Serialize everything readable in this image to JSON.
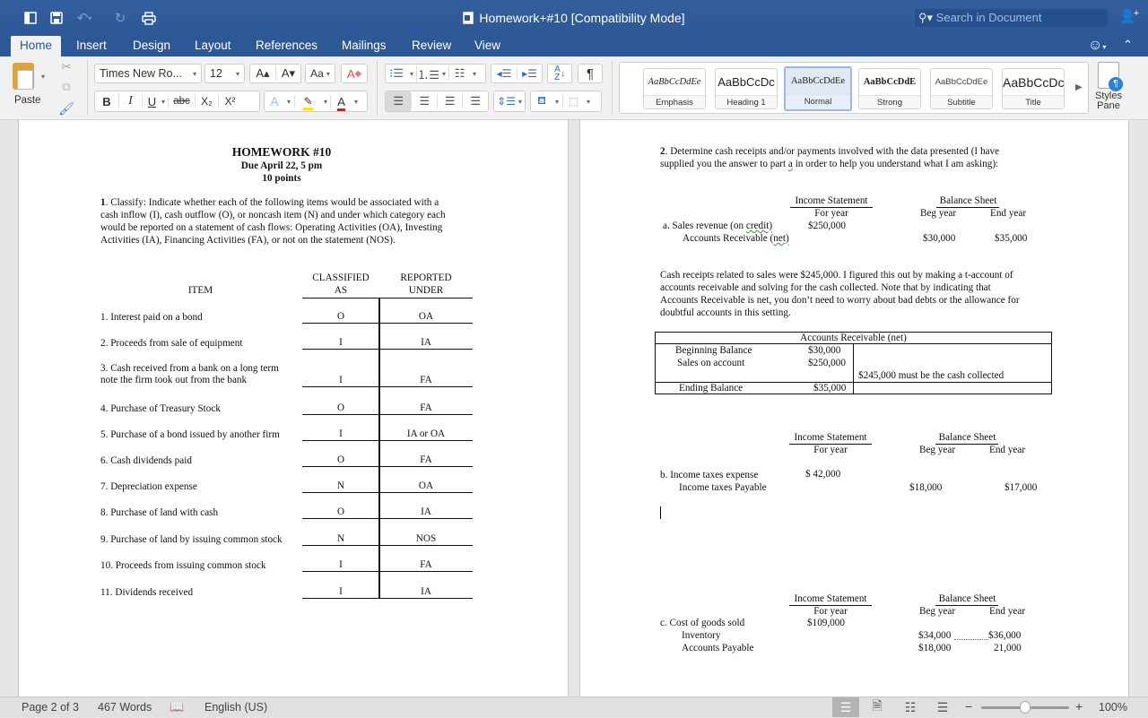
{
  "titlebar": {
    "title": "Homework+#10 [Compatibility Mode]",
    "search_placeholder": "Search in Document",
    "icons": [
      "sidebar-icon",
      "save-icon",
      "undo-icon",
      "redo-icon",
      "print-icon",
      "share-icon"
    ]
  },
  "tabs": [
    {
      "label": "Home",
      "active": true
    },
    {
      "label": "Insert"
    },
    {
      "label": "Design"
    },
    {
      "label": "Layout"
    },
    {
      "label": "References"
    },
    {
      "label": "Mailings"
    },
    {
      "label": "Review"
    },
    {
      "label": "View"
    }
  ],
  "ribbon": {
    "paste_label": "Paste",
    "font_name": "Times New Ro...",
    "font_size": "12",
    "grow_font": "A▴",
    "shrink_font": "A▾",
    "change_case": "Aa",
    "bold": "B",
    "italic": "I",
    "underline": "U",
    "strikethrough": "abc",
    "subscript": "X₂",
    "superscript": "X²",
    "text_effects": "A",
    "font_color": "A",
    "pilcrow": "¶",
    "styles": [
      {
        "sample": "AaBbCcDdEe",
        "name": "Emphasis"
      },
      {
        "sample": "AaBbCcDc",
        "name": "Heading 1"
      },
      {
        "sample": "AaBbCcDdEe",
        "name": "Normal",
        "selected": true
      },
      {
        "sample": "AaBbCcDdE",
        "name": "Strong"
      },
      {
        "sample": "AaBbCcDdEe",
        "name": "Subtitle"
      },
      {
        "sample": "AaBbCcDc",
        "name": "Title"
      }
    ],
    "styles_pane_line1": "Styles",
    "styles_pane_line2": "Pane"
  },
  "page1": {
    "title": "HOMEWORK #10",
    "due": "Due April 22, 5 pm",
    "points": "10 points",
    "q1_num": "1",
    "q1_lines": [
      ".  Classify:  Indicate whether each of the following items would be associated with a",
      "cash inflow (I), cash outflow (O), or noncash item (N) and under which category each",
      "would be reported on a statement of cash flows:  Operating Activities (OA), Investing",
      "Activities (IA), Financing Activities (FA), or not on the statement (NOS)."
    ],
    "headers": {
      "item": "ITEM",
      "classified_1": "CLASSIFIED",
      "classified_2": "AS",
      "reported_1": "REPORTED",
      "reported_2": "UNDER"
    },
    "rows": [
      {
        "item": "1.  Interest paid on a bond",
        "classified": "O",
        "reported": "OA"
      },
      {
        "item": "2.  Proceeds from sale of equipment",
        "classified": "I",
        "reported": "IA"
      },
      {
        "item": "3.  Cash received from a bank on a long term",
        "item2": "note the firm took out from the bank",
        "classified": "I",
        "reported": "FA"
      },
      {
        "item": "4.  Purchase of Treasury Stock",
        "classified": "O",
        "reported": "FA"
      },
      {
        "item": "5.  Purchase of a bond issued by another firm",
        "classified": "I",
        "reported": "IA or OA"
      },
      {
        "item": "6.  Cash dividends paid",
        "classified": "O",
        "reported": "FA"
      },
      {
        "item": "7.  Depreciation expense",
        "classified": "N",
        "reported": "OA"
      },
      {
        "item": "8.  Purchase of land with cash",
        "classified": "O",
        "reported": "IA"
      },
      {
        "item": "9.  Purchase of land by issuing common stock",
        "classified": "N",
        "reported": "NOS"
      },
      {
        "item": "10.  Proceeds from issuing common stock",
        "classified": "I",
        "reported": "FA"
      },
      {
        "item": "11. Dividends received",
        "classified": "I",
        "reported": "IA"
      }
    ]
  },
  "page2": {
    "q2_num": "2",
    "q2_line1": ".  Determine cash receipts and/or payments involved with the data presented (I have",
    "q2_line2a": "supplied you the answer to part ",
    "q2_line2b": "a",
    "q2_line2c": " in order to help you understand what I am asking):",
    "income_statement": "Income Statement",
    "for_year": "For year",
    "balance_sheet": "Balance Sheet",
    "beg_year": "Beg year",
    "end_year": "End year",
    "part_a": {
      "line1_pre": "a.  Sales revenue (on ",
      "line1_sq": "credit)",
      "line2_pre": "Accounts Receivable (",
      "line2_sq": "net)",
      "is_value": "$250,000",
      "beg": "$30,000",
      "end": "$35,000"
    },
    "explanation": [
      "Cash receipts related to sales were $245,000.  I figured this out by making a t-account of",
      "accounts receivable and solving for the cash collected. Note that by indicating that",
      "Accounts Receivable is net, you don’t need to worry about bad debts or the allowance for",
      "doubtful accounts in this setting."
    ],
    "t_account": {
      "title": "Accounts Receivable (net)",
      "beginning_label": "Beginning Balance",
      "beginning_value": "$30,000",
      "sales_label": "Sales on account",
      "sales_value": "$250,000",
      "credit_note": "$245,000  must be the cash collected",
      "ending_label": "Ending Balance",
      "ending_value": "$35,000"
    },
    "part_b": {
      "line1": "b.  Income taxes expense",
      "line2": "Income taxes Payable",
      "is_value": "$ 42,000",
      "beg": "$18,000",
      "end": "$17,000"
    },
    "part_c": {
      "line1": "c.  Cost of goods sold",
      "line2": "Inventory",
      "line3": "Accounts Payable",
      "is_value": "$109,000",
      "inv_beg": "$34,000",
      "inv_end": "$36,000",
      "ap_beg": "$18,000",
      "ap_end": "21,000"
    }
  },
  "statusbar": {
    "page": "Page 2 of 3",
    "words": "467 Words",
    "language": "English (US)",
    "zoom": "100%",
    "zoom_value_percent": 100,
    "zoom_minus": "−",
    "zoom_plus": "+"
  }
}
